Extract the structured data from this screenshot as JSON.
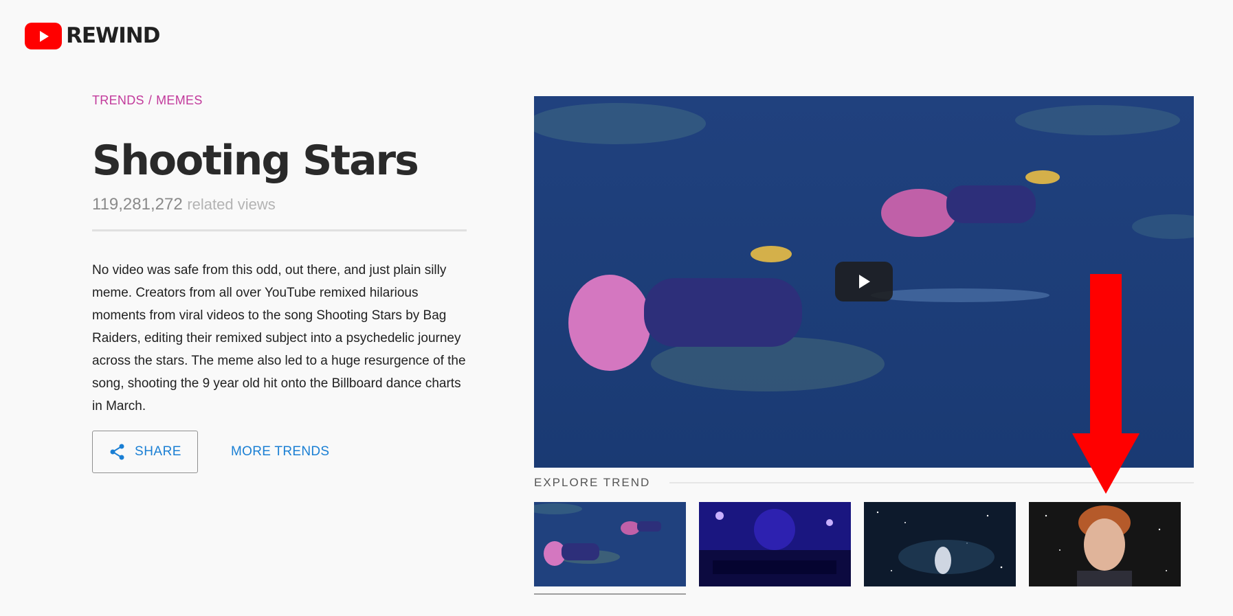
{
  "logo": {
    "text": "REWIND",
    "icon": "youtube-play-icon",
    "brand_color": "#ff0000"
  },
  "breadcrumb": {
    "section": "TRENDS",
    "separator": "/",
    "category": "MEMES",
    "color": "#c2399b"
  },
  "trend": {
    "title": "Shooting Stars",
    "view_count": "119,281,272",
    "view_label": "related views",
    "description": "No video was safe from this odd, out there, and just plain silly meme. Creators from all over YouTube remixed hilarious moments from viral videos to the song Shooting Stars by Bag Raiders, editing their remixed subject into a psychedelic journey across the stars. The meme also led to a huge resurgence of the song, shooting the 9 year old hit onto the Billboard dance charts in March."
  },
  "actions": {
    "share_label": "SHARE",
    "share_icon": "share-icon",
    "more_label": "MORE TRENDS",
    "link_color": "#1a7fd4"
  },
  "player": {
    "play_icon": "play-icon"
  },
  "explore": {
    "label": "EXPLORE TREND",
    "thumbnails": [
      {
        "name": "thumb-underwater",
        "active": true
      },
      {
        "name": "thumb-concert"
      },
      {
        "name": "thumb-space-dancer"
      },
      {
        "name": "thumb-singer"
      }
    ]
  },
  "annotation": {
    "arrow_color": "#ff0000",
    "arrow_icon": "red-arrow-down-icon"
  }
}
